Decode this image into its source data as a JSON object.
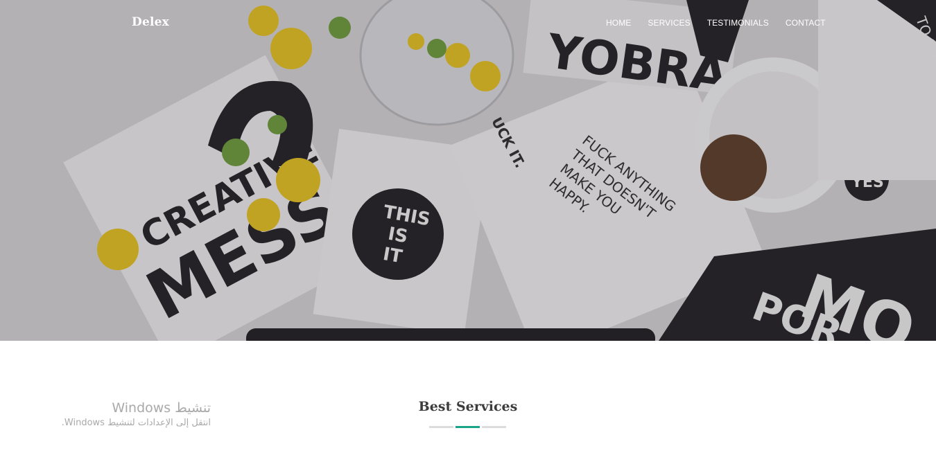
{
  "header": {
    "brand": "Delex",
    "nav": [
      {
        "label": "HOME"
      },
      {
        "label": "SERVICES"
      },
      {
        "label": "TESTIMONIALS"
      },
      {
        "label": "CONTACT"
      }
    ]
  },
  "hero": {
    "poster_texts": {
      "creative": "CREATIVE",
      "mess": "MESS",
      "this_is_it": [
        "THIS",
        "IS",
        "IT"
      ],
      "slogan": [
        "FUCK ANYTHING",
        "THAT DOESN'T",
        "MAKE YOU",
        "HAPPY."
      ],
      "suck_it": "UCK IT.",
      "yobra": "YOBRA",
      "yes": "YES",
      "to_sh": "TO SH"
    }
  },
  "services": {
    "title": "Best Services"
  },
  "watermark": {
    "title": "تنشيط Windows",
    "subtitle": "انتقل إلى الإعدادات لتنشيط Windows."
  },
  "colors": {
    "accent": "#1aa58a",
    "divider_gray": "#dcdcdc",
    "title_text": "#3c3c3c"
  }
}
